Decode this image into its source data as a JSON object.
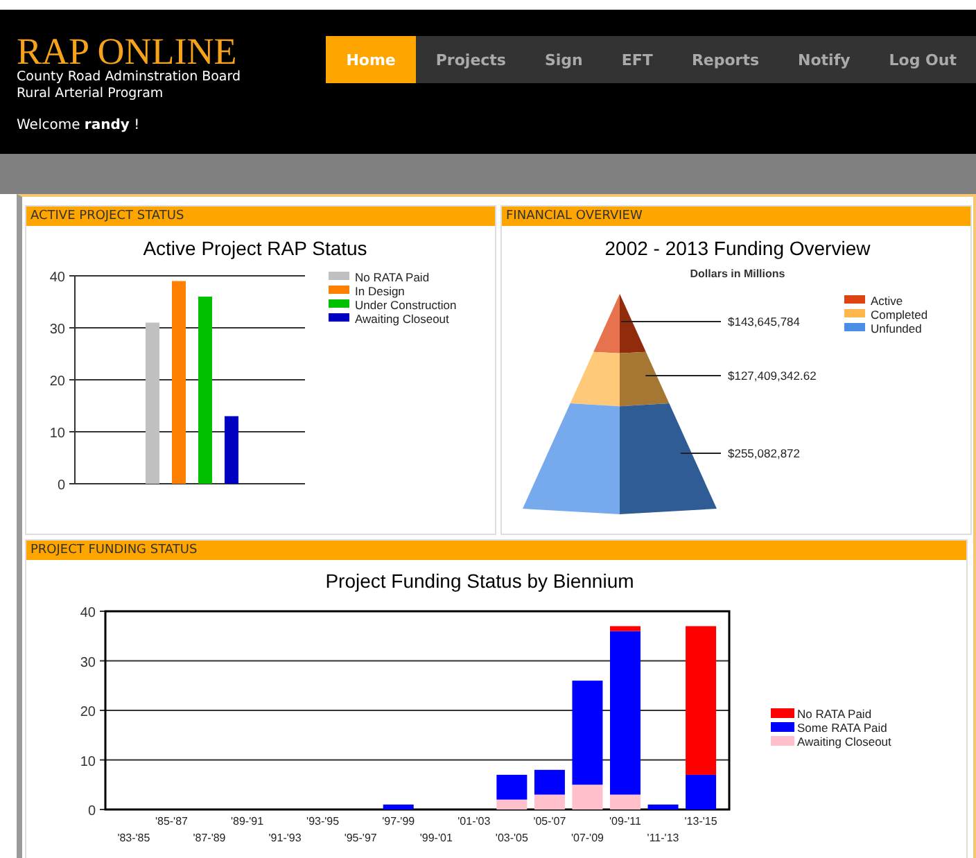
{
  "header": {
    "logo": "RAP ONLINE",
    "subtitle_lines": [
      "County Road Adminstration Board",
      "Rural Arterial Program"
    ],
    "welcome": "Welcome **randy** !"
  },
  "nav": [
    {
      "label": "Home",
      "selected": true
    },
    {
      "label": "Projects",
      "selected": false
    },
    {
      "label": "Sign",
      "selected": false
    },
    {
      "label": "EFT",
      "selected": false
    },
    {
      "label": "Reports",
      "selected": false
    },
    {
      "label": "Notify",
      "selected": false
    },
    {
      "label": "Log Out",
      "selected": false
    }
  ],
  "active_project_status": {
    "heading": "ACTIVE PROJECT STATUS",
    "chart_data": {
      "type": "bar",
      "title": "Active Project RAP Status",
      "categories": [
        null
      ],
      "grid": true,
      "legend": true,
      "ylim": [
        0,
        40
      ],
      "yticks": [
        0,
        10,
        20,
        30,
        40
      ],
      "series": [
        {
          "name": "No RATA Paid",
          "color": "#c0c0c0",
          "values": [
            31
          ]
        },
        {
          "name": "In Design",
          "color": "#ff8000",
          "values": [
            39
          ]
        },
        {
          "name": "Under Construction",
          "color": "#00c000",
          "values": [
            36
          ]
        },
        {
          "name": "Awaiting Closeout",
          "color": "#0000c0",
          "values": [
            13
          ]
        }
      ]
    }
  },
  "financial_overview": {
    "heading": "FINANCIAL OVERVIEW",
    "title": "2002 - 2013 Funding Overview",
    "subtitle": "Dollars in Millions",
    "segments": [
      {
        "name": "Active",
        "amount": "$143,645,784",
        "color": "#dd4411"
      },
      {
        "name": "Completed",
        "amount": "$127,409,342.62",
        "color": "#ffb74d"
      },
      {
        "name": "Unfunded",
        "amount": "$255,082,872",
        "color": "#4a8ee6"
      }
    ]
  },
  "project_funding_status": {
    "heading": "PROJECT FUNDING STATUS",
    "chart_data": {
      "type": "bar",
      "stacked": true,
      "title": "Project Funding Status by Biennium",
      "categories": [
        "'83-'85",
        "'85-'87",
        "'87-'89",
        "'89-'91",
        "'91-'93",
        "'93-'95",
        "'95-'97",
        "'97-'99",
        "'99-'01",
        "'01-'03",
        "'03-'05",
        "'05-'07",
        "'07-'09",
        "'09-'11",
        "'11-'13",
        "'13-'15"
      ],
      "grid": true,
      "legend": true,
      "ylim": [
        0,
        40
      ],
      "yticks": [
        0,
        10,
        20,
        30,
        40
      ],
      "series": [
        {
          "name": "Awaiting Closeout",
          "color": "#ffc0cb",
          "values": [
            0,
            0,
            0,
            0,
            0,
            0,
            0,
            0,
            0,
            0,
            2,
            3,
            5,
            3,
            0,
            0
          ]
        },
        {
          "name": "Some RATA Paid",
          "color": "#0000ff",
          "values": [
            0,
            0,
            0,
            0,
            0,
            0,
            0,
            1,
            0,
            0,
            5,
            5,
            21,
            33,
            1,
            7
          ]
        },
        {
          "name": "No RATA Paid",
          "color": "#ff0000",
          "values": [
            0,
            0,
            0,
            0,
            0,
            0,
            0,
            0,
            0,
            0,
            0,
            0,
            0,
            1,
            0,
            30
          ]
        }
      ]
    }
  }
}
